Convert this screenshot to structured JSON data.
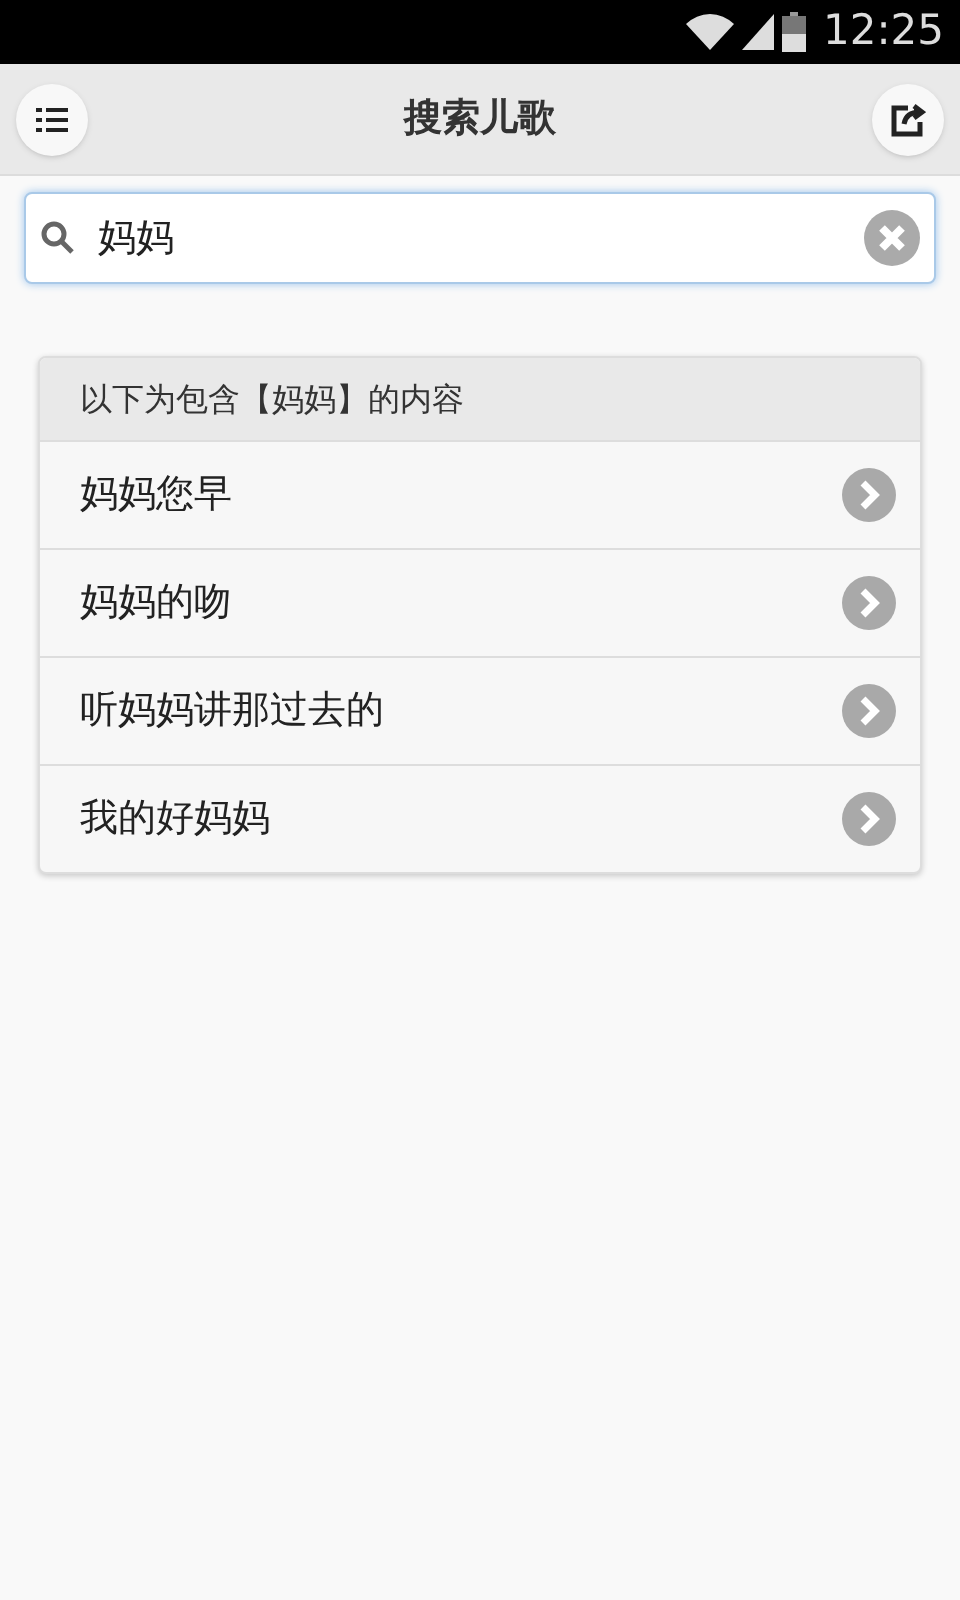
{
  "status_bar": {
    "time": "12:25"
  },
  "header": {
    "title": "搜索儿歌"
  },
  "search": {
    "value": "妈妈"
  },
  "results": {
    "heading": "以下为包含【妈妈】的内容",
    "items": [
      {
        "label": "妈妈您早"
      },
      {
        "label": "妈妈的吻"
      },
      {
        "label": "听妈妈讲那过去的"
      },
      {
        "label": "我的好妈妈"
      }
    ]
  }
}
